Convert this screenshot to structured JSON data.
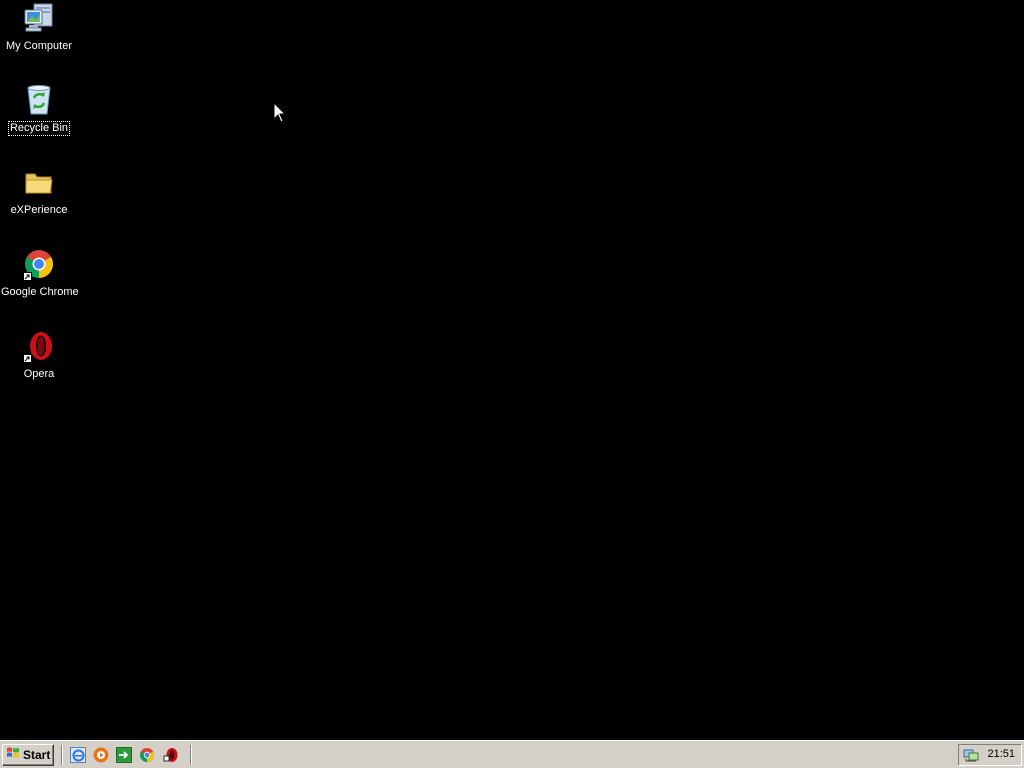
{
  "desktop": {
    "background_color": "#000000",
    "icons": [
      {
        "label": "My Computer",
        "icon": "my-computer-icon",
        "shortcut": false,
        "selected": false
      },
      {
        "label": "Recycle Bin",
        "icon": "recycle-bin-icon",
        "shortcut": false,
        "selected": true
      },
      {
        "label": "eXPerience",
        "icon": "folder-icon",
        "shortcut": false,
        "selected": false
      },
      {
        "label": "Google Chrome",
        "icon": "chrome-icon",
        "shortcut": true,
        "selected": false
      },
      {
        "label": "Opera",
        "icon": "opera-icon",
        "shortcut": true,
        "selected": false
      }
    ]
  },
  "taskbar": {
    "start_label": "Start",
    "quick_launch": [
      "internet-explorer-icon",
      "media-player-icon",
      "show-desktop-icon",
      "chrome-icon",
      "opera-icon"
    ],
    "tray": {
      "network_icon": "network-connection-icon",
      "clock": "21:51"
    }
  }
}
